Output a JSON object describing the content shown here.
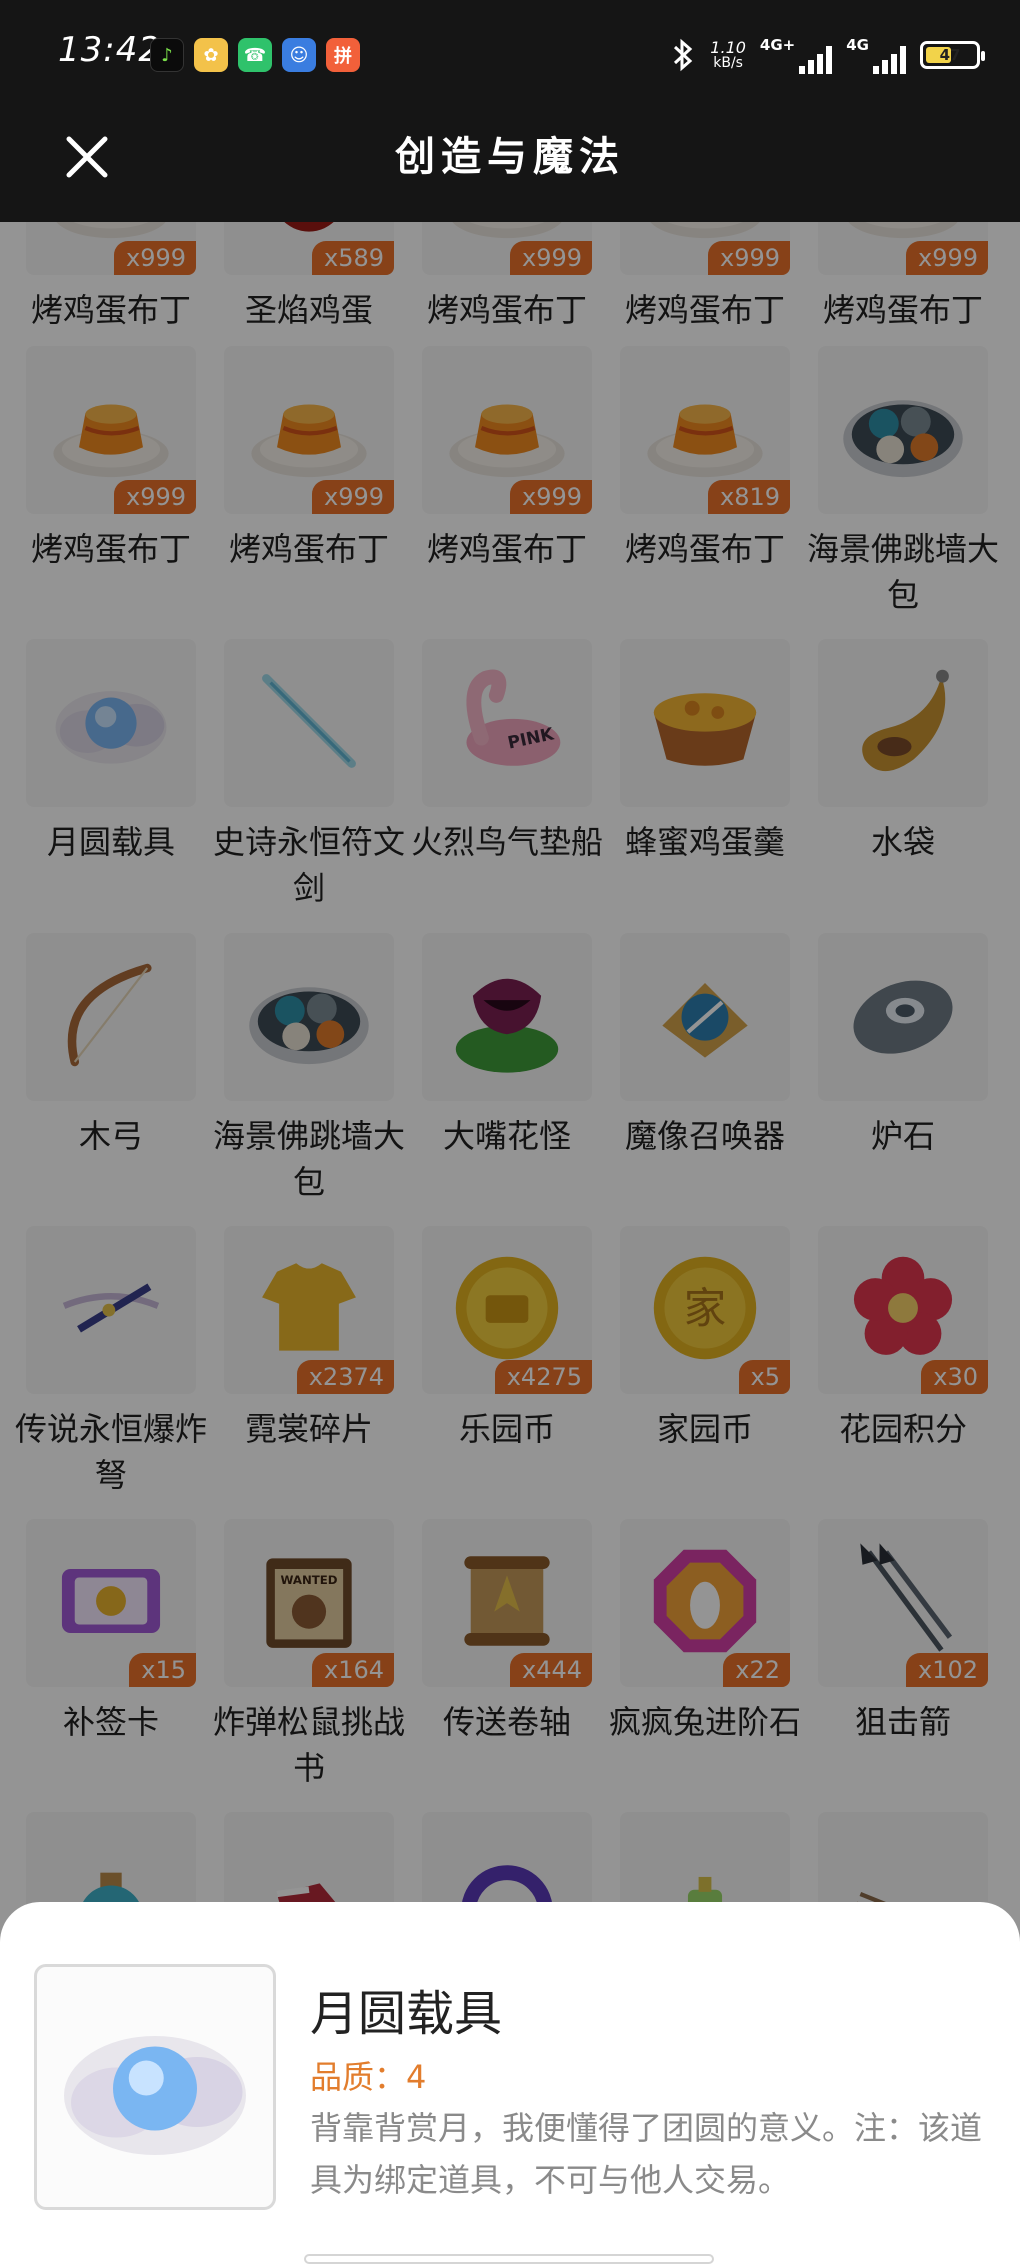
{
  "status_bar": {
    "time": "13:42",
    "network_speed_value": "1.10",
    "network_speed_unit": "kB/s",
    "sim1_label": "4G+",
    "sim2_label": "4G",
    "battery": "47"
  },
  "header": {
    "title": "创造与魔法"
  },
  "items": [
    {
      "name": "烤鸡蛋布丁",
      "qty": "x999",
      "icon": "pudding"
    },
    {
      "name": "圣焰鸡蛋",
      "qty": "x589",
      "icon": "red-egg"
    },
    {
      "name": "烤鸡蛋布丁",
      "qty": "x999",
      "icon": "pudding"
    },
    {
      "name": "烤鸡蛋布丁",
      "qty": "x999",
      "icon": "pudding"
    },
    {
      "name": "烤鸡蛋布丁",
      "qty": "x999",
      "icon": "pudding"
    },
    {
      "name": "烤鸡蛋布丁",
      "qty": "x999",
      "icon": "pudding"
    },
    {
      "name": "烤鸡蛋布丁",
      "qty": "x999",
      "icon": "pudding"
    },
    {
      "name": "烤鸡蛋布丁",
      "qty": "x999",
      "icon": "pudding"
    },
    {
      "name": "烤鸡蛋布丁",
      "qty": "x819",
      "icon": "pudding"
    },
    {
      "name": "海景佛跳墙大包",
      "qty": "",
      "icon": "buns"
    },
    {
      "name": "月圆载具",
      "qty": "",
      "icon": "moon-orb"
    },
    {
      "name": "史诗永恒符文剑",
      "qty": "",
      "icon": "rune-sword"
    },
    {
      "name": "火烈鸟气垫船",
      "qty": "",
      "icon": "flamingo"
    },
    {
      "name": "蜂蜜鸡蛋羹",
      "qty": "",
      "icon": "honey-bowl"
    },
    {
      "name": "水袋",
      "qty": "",
      "icon": "water-bag"
    },
    {
      "name": "木弓",
      "qty": "",
      "icon": "bow"
    },
    {
      "name": "海景佛跳墙大包",
      "qty": "",
      "icon": "buns"
    },
    {
      "name": "大嘴花怪",
      "qty": "",
      "icon": "plant-monster"
    },
    {
      "name": "魔像召唤器",
      "qty": "",
      "icon": "golem-summoner"
    },
    {
      "name": "炉石",
      "qty": "",
      "icon": "hearthstone"
    },
    {
      "name": "传说永恒爆炸弩",
      "qty": "",
      "icon": "crossbow"
    },
    {
      "name": "霓裳碎片",
      "qty": "x2374",
      "icon": "shirt"
    },
    {
      "name": "乐园币",
      "qty": "x4275",
      "icon": "gold-coin"
    },
    {
      "name": "家园币",
      "qty": "x5",
      "icon": "home-coin"
    },
    {
      "name": "花园积分",
      "qty": "x30",
      "icon": "flower-badge"
    },
    {
      "name": "补签卡",
      "qty": "x15",
      "icon": "sign-card"
    },
    {
      "name": "炸弹松鼠挑战书",
      "qty": "x164",
      "icon": "wanted-poster"
    },
    {
      "name": "传送卷轴",
      "qty": "x444",
      "icon": "scroll"
    },
    {
      "name": "疯疯兔进阶石",
      "qty": "x22",
      "icon": "gem"
    },
    {
      "name": "狙击箭",
      "qty": "x102",
      "icon": "arrows"
    },
    {
      "name": "",
      "qty": "",
      "icon": "potion"
    },
    {
      "name": "",
      "qty": "",
      "icon": "shoe"
    },
    {
      "name": "",
      "qty": "",
      "icon": "purple-ring"
    },
    {
      "name": "",
      "qty": "",
      "icon": "green-item"
    },
    {
      "name": "",
      "qty": "",
      "icon": "sword-item"
    }
  ],
  "detail": {
    "name": "月圆载具",
    "quality": "品质：4",
    "description": "背靠背赏月，我便懂得了团圆的意义。注：该道具为绑定道具，不可与他人交易。",
    "icon": "moon-orb"
  }
}
